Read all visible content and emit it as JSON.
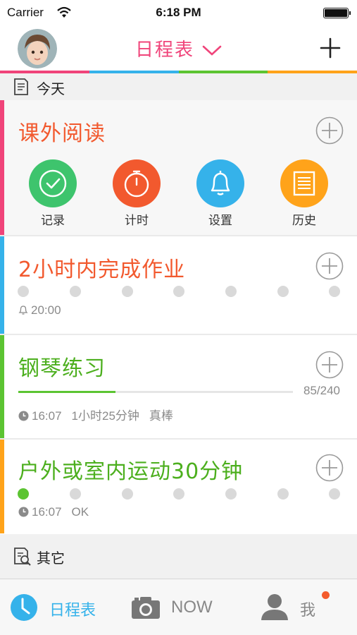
{
  "status_bar": {
    "carrier": "Carrier",
    "time": "6:18 PM"
  },
  "nav": {
    "title": "日程表"
  },
  "colors": {
    "pink": "#f0447a",
    "blue": "#35b2ea",
    "green": "#5cc432",
    "orange": "#ffa31a",
    "title_orange": "#f2592e",
    "title_green": "#4caf1e"
  },
  "sections": {
    "today": "今天",
    "other": "其它"
  },
  "cards": {
    "reading": {
      "title": "课外阅读",
      "actions": [
        {
          "label": "记录",
          "icon": "check-icon",
          "color": "#3ec46d"
        },
        {
          "label": "计时",
          "icon": "stopwatch-icon",
          "color": "#f2592e"
        },
        {
          "label": "设置",
          "icon": "bell-icon",
          "color": "#35b2ea"
        },
        {
          "label": "历史",
          "icon": "list-icon",
          "color": "#ffa31a"
        }
      ]
    },
    "homework": {
      "title": "2小时内完成作业",
      "reminder": "20:00",
      "dots_done": 0,
      "dots_total": 7
    },
    "piano": {
      "title": "钢琴练习",
      "progress_value": 85,
      "progress_max": 240,
      "progress_text": "85/240",
      "time": "16:07",
      "duration": "1小时25分钟",
      "comment": "真棒"
    },
    "sport": {
      "title": "户外或室内运动30分钟",
      "dots_done": 1,
      "dots_total": 7,
      "time": "16:07",
      "comment": "OK"
    }
  },
  "tabs": [
    {
      "label": "日程表",
      "icon": "clock-icon",
      "active": true
    },
    {
      "label": "NOW",
      "icon": "camera-icon",
      "active": false
    },
    {
      "label": "我",
      "icon": "user-icon",
      "active": false,
      "badge": true
    }
  ]
}
